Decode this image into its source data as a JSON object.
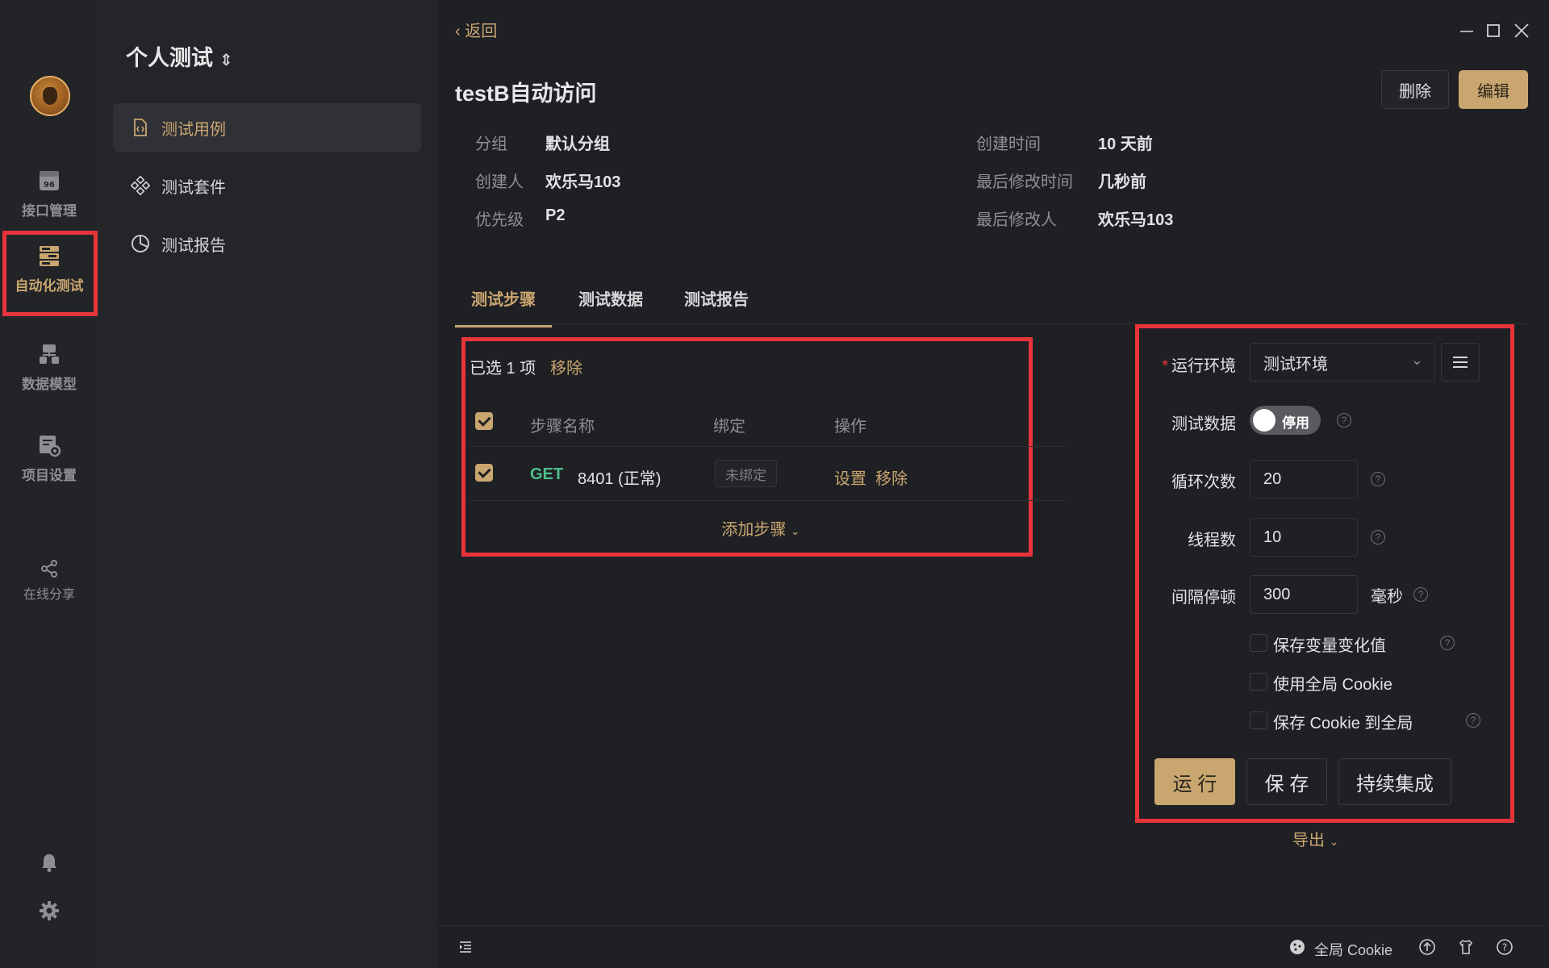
{
  "rail": {
    "items": [
      {
        "label": "接口管理",
        "icon": "api-management-icon"
      },
      {
        "label": "自动化测试",
        "icon": "automation-test-icon"
      },
      {
        "label": "数据模型",
        "icon": "data-model-icon"
      },
      {
        "label": "项目设置",
        "icon": "project-settings-icon"
      }
    ],
    "share": {
      "label": "在线分享",
      "icon": "share-icon"
    }
  },
  "sidebar": {
    "project_title": "个人测试",
    "items": [
      {
        "label": "测试用例",
        "icon": "file-code-icon"
      },
      {
        "label": "测试套件",
        "icon": "suite-icon"
      },
      {
        "label": "测试报告",
        "icon": "pie-chart-icon"
      }
    ]
  },
  "header": {
    "back": "返回",
    "title": "testB自动访问",
    "delete_label": "删除",
    "edit_label": "编辑"
  },
  "meta": {
    "group_label": "分组",
    "group_value": "默认分组",
    "creator_label": "创建人",
    "creator_value": "欢乐马103",
    "priority_label": "优先级",
    "priority_value": "P2",
    "created_label": "创建时间",
    "created_value": "10 天前",
    "modified_label": "最后修改时间",
    "modified_value": "几秒前",
    "modifier_label": "最后修改人",
    "modifier_value": "欢乐马103"
  },
  "tabs": [
    "测试步骤",
    "测试数据",
    "测试报告"
  ],
  "steps": {
    "selected_info": "已选 1 项",
    "remove": "移除",
    "columns": [
      "步骤名称",
      "绑定",
      "操作"
    ],
    "rows": [
      {
        "method": "GET",
        "name": "8401 (正常)",
        "binding": "未绑定",
        "op_set": "设置",
        "op_remove": "移除"
      }
    ],
    "add_step": "添加步骤"
  },
  "config": {
    "env_label": "运行环境",
    "env_value": "测试环境",
    "test_data_label": "测试数据",
    "test_data_toggle": "停用",
    "loop_label": "循环次数",
    "loop_value": "20",
    "threads_label": "线程数",
    "threads_value": "10",
    "interval_label": "间隔停顿",
    "interval_value": "300",
    "interval_unit": "毫秒",
    "opt1": "保存变量变化值",
    "opt2": "使用全局 Cookie",
    "opt3": "保存 Cookie 到全局",
    "run": "运 行",
    "save": "保 存",
    "ci": "持续集成",
    "export": "导出"
  },
  "statusbar": {
    "global_cookie": "全局 Cookie"
  },
  "colors": {
    "accent": "#c9a670",
    "highlight": "#e8343a",
    "method_get": "#4fbf8a"
  }
}
